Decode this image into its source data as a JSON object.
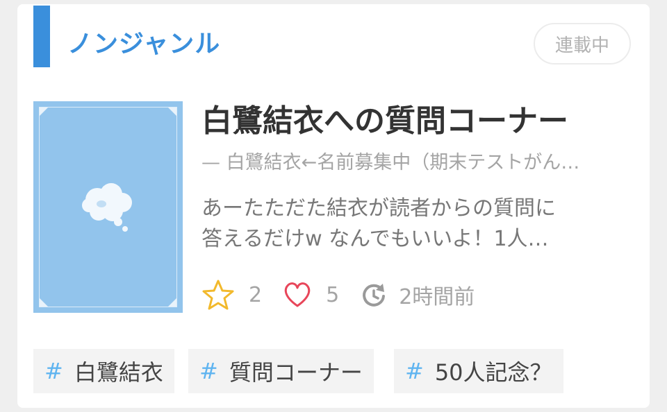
{
  "genre": "ノンジャンル",
  "status": "連載中",
  "title": "白鷺結衣への質問コーナー",
  "author": "— 白鷺結衣←名前募集中（期末テストがん…",
  "description": {
    "line1": "あーたただた結衣が読者からの質問に",
    "line2": "答えるだけw なんでもいいよ！1人…"
  },
  "stats": {
    "stars": "2",
    "likes": "5",
    "updated": "2時間前"
  },
  "tags": [
    {
      "hash": "#",
      "label": "白鷺結衣"
    },
    {
      "hash": "#",
      "label": "質問コーナー"
    },
    {
      "hash": "#",
      "label": "50人記念？"
    }
  ],
  "colors": {
    "accent": "#3a8fdc",
    "cover": "#92c4ec",
    "star": "#f2b92c",
    "heart": "#e8465a"
  },
  "icons": {
    "cover": "thought-bubble-icon",
    "star": "star-icon",
    "heart": "heart-icon",
    "updated": "refresh-clock-icon"
  }
}
